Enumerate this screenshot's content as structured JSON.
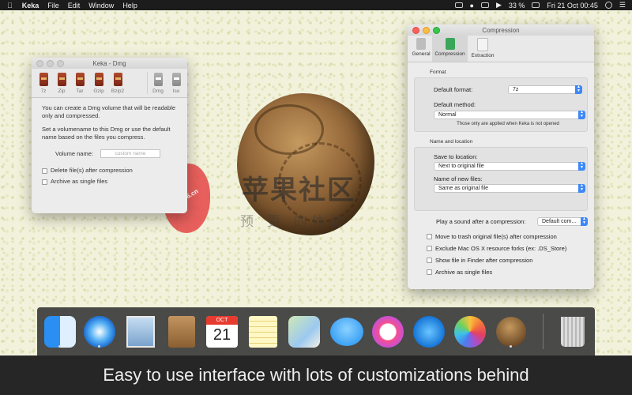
{
  "menubar": {
    "app_name": "Keka",
    "menus": [
      "File",
      "Edit",
      "Window",
      "Help"
    ],
    "battery": "33 %",
    "clock": "Fri 21 Oct  00:45"
  },
  "dmg_window": {
    "title": "Keka - Dmg",
    "formats": [
      {
        "label": "7z"
      },
      {
        "label": "Zip"
      },
      {
        "label": "Tar"
      },
      {
        "label": "Gzip"
      },
      {
        "label": "Bzip2"
      },
      {
        "label": "Dmg"
      },
      {
        "label": "Iso"
      }
    ],
    "description1": "You can create a Dmg volume that will be readable only and compressed.",
    "description2": "Set a volumename to this Dmg or use the default name based on the files you compress.",
    "volume_name_label": "Volume name:",
    "volume_name_placeholder": "custom name",
    "delete_files_label": "Delete file(s) after compression",
    "archive_single_label": "Archive as single files"
  },
  "compression_window": {
    "title": "Compression",
    "tabs": [
      {
        "label": "General"
      },
      {
        "label": "Compression"
      },
      {
        "label": "Extraction"
      }
    ],
    "format_section": "Format",
    "default_format_label": "Default format:",
    "default_format_value": "7z",
    "default_method_label": "Default method:",
    "default_method_value": "Normal",
    "note": "Those only are applied when Keka is not opened",
    "location_section": "Name and location",
    "save_location_label": "Save to location:",
    "save_location_value": "Next to original file",
    "name_files_label": "Name of new files:",
    "name_files_value": "Same as original file",
    "sound_label": "Play a sound after a compression:",
    "sound_value": "Default com...",
    "options": [
      "Move to trash original file(s) after compression",
      "Exclude Mac OS X resource forks (ex: .DS_Store)",
      "Show file in Finder after compression",
      "Archive as single files"
    ]
  },
  "watermark": {
    "site": "macx86.cn",
    "title": "苹果社区",
    "subtitle": "预 更 的体验"
  },
  "dock": {
    "calendar_month": "OCT",
    "calendar_day": "21",
    "apps": [
      "finder-icon",
      "safari-icon",
      "mail-icon",
      "contacts-icon",
      "calendar-icon",
      "notes-icon",
      "maps-icon",
      "messages-icon",
      "itunes-icon",
      "app-store-icon",
      "photos-icon",
      "keka-icon",
      "trash-icon"
    ]
  },
  "caption": "Easy to use interface with lots of customizations behind"
}
